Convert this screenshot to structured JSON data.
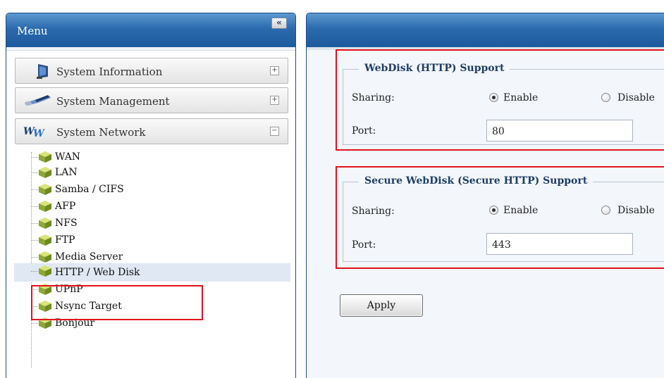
{
  "menu": {
    "title": "Menu",
    "collapse_glyph": "«",
    "sections": [
      {
        "label": "System Information",
        "toggle": "+",
        "icon": "monitor-icon"
      },
      {
        "label": "System Management",
        "toggle": "+",
        "icon": "wrench-icon"
      },
      {
        "label": "System Network",
        "toggle": "−",
        "icon": "network-icon"
      }
    ],
    "network_items": [
      {
        "label": "WAN"
      },
      {
        "label": "LAN"
      },
      {
        "label": "Samba / CIFS"
      },
      {
        "label": "AFP"
      },
      {
        "label": "NFS"
      },
      {
        "label": "FTP"
      },
      {
        "label": "Media Server"
      },
      {
        "label": "HTTP / Web Disk",
        "selected": true
      },
      {
        "label": "UPnP"
      },
      {
        "label": "Nsync Target"
      },
      {
        "label": "Bonjour"
      }
    ]
  },
  "webdisk": {
    "legend": "WebDisk (HTTP) Support",
    "sharing_label": "Sharing:",
    "enable_label": "Enable",
    "disable_label": "Disable",
    "sharing_value": "Enable",
    "port_label": "Port:",
    "port_value": "80"
  },
  "secure_webdisk": {
    "legend": "Secure WebDisk (Secure HTTP) Support",
    "sharing_label": "Sharing:",
    "enable_label": "Enable",
    "disable_label": "Disable",
    "sharing_value": "Enable",
    "port_label": "Port:",
    "port_value": "443"
  },
  "apply_label": "Apply",
  "colors": {
    "header_blue": "#2a6aad",
    "highlight_red": "#e0141e",
    "selected_row": "#dfe8f3"
  }
}
